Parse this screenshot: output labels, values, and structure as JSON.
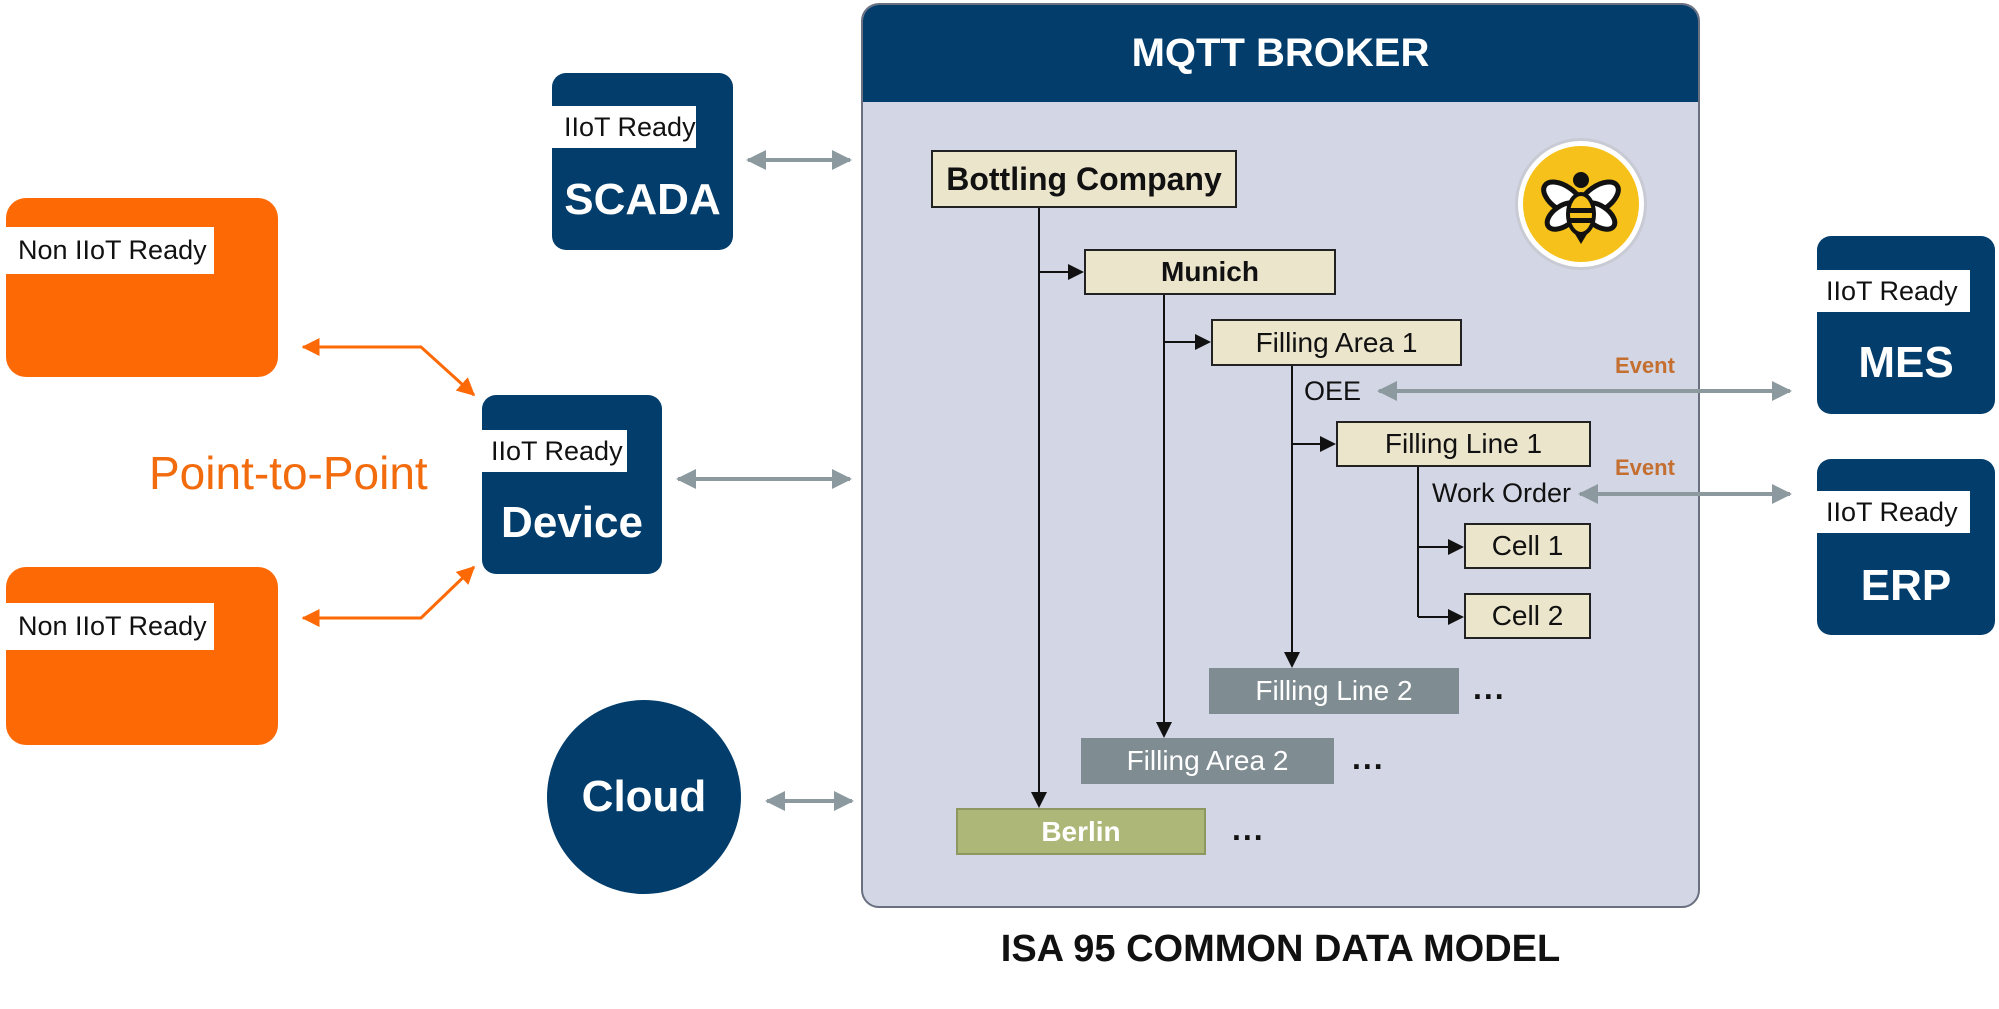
{
  "colors": {
    "navy": "#023d6b",
    "orange": "#fd6905",
    "broker_bg": "#d3d6e4",
    "node_bg": "#ebe5cc",
    "node_muted": "#7f8c92",
    "node_berlin": "#adb878",
    "arrow_gray": "#8c9aa0",
    "event": "#c46f2f",
    "bee_yellow": "#f5c11a"
  },
  "legacy": {
    "items": [
      {
        "tag": "Non IIoT Ready"
      },
      {
        "tag": "Non IIoT Ready"
      }
    ],
    "label": "Point-to-Point"
  },
  "clients": {
    "scada": {
      "tag": "IIoT Ready",
      "name": "SCADA"
    },
    "device": {
      "tag": "IIoT Ready",
      "name": "Device"
    },
    "cloud": {
      "name": "Cloud"
    },
    "mes": {
      "tag": "IIoT Ready",
      "name": "MES"
    },
    "erp": {
      "tag": "IIoT Ready",
      "name": "ERP"
    }
  },
  "broker": {
    "title": "MQTT BROKER",
    "logo_icon": "bee-icon"
  },
  "tree": {
    "enterprise": "Bottling Company",
    "site1": "Munich",
    "area1": "Filling Area 1",
    "area1_metric": "OEE",
    "line1": "Filling Line 1",
    "line1_metric": "Work Order",
    "cell1": "Cell 1",
    "cell2": "Cell 2",
    "line2": "Filling Line 2",
    "area2": "Filling Area 2",
    "site2": "Berlin",
    "ellipsis": "..."
  },
  "events": {
    "oee": "Event",
    "work_order": "Event"
  },
  "footer": {
    "title": "ISA 95 COMMON DATA MODEL"
  }
}
